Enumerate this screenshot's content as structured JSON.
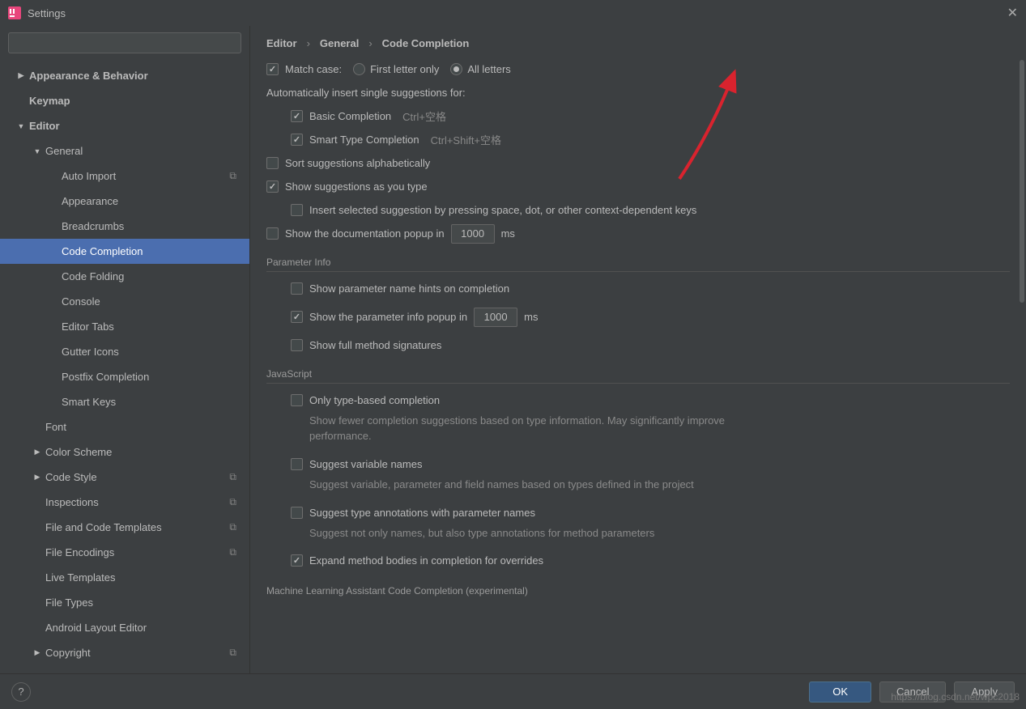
{
  "window": {
    "title": "Settings"
  },
  "search": {
    "placeholder": ""
  },
  "tree": [
    {
      "label": "Appearance & Behavior",
      "lv": 0,
      "arrow": "right",
      "bold": true
    },
    {
      "label": "Keymap",
      "lv": 0,
      "arrow": "",
      "bold": true
    },
    {
      "label": "Editor",
      "lv": 0,
      "arrow": "down",
      "bold": true
    },
    {
      "label": "General",
      "lv": 1,
      "arrow": "down"
    },
    {
      "label": "Auto Import",
      "lv": 2,
      "arrow": "",
      "copy": true
    },
    {
      "label": "Appearance",
      "lv": 2,
      "arrow": ""
    },
    {
      "label": "Breadcrumbs",
      "lv": 2,
      "arrow": ""
    },
    {
      "label": "Code Completion",
      "lv": 2,
      "arrow": "",
      "selected": true
    },
    {
      "label": "Code Folding",
      "lv": 2,
      "arrow": ""
    },
    {
      "label": "Console",
      "lv": 2,
      "arrow": ""
    },
    {
      "label": "Editor Tabs",
      "lv": 2,
      "arrow": ""
    },
    {
      "label": "Gutter Icons",
      "lv": 2,
      "arrow": ""
    },
    {
      "label": "Postfix Completion",
      "lv": 2,
      "arrow": ""
    },
    {
      "label": "Smart Keys",
      "lv": 2,
      "arrow": ""
    },
    {
      "label": "Font",
      "lv": 1,
      "arrow": ""
    },
    {
      "label": "Color Scheme",
      "lv": 1,
      "arrow": "right"
    },
    {
      "label": "Code Style",
      "lv": 1,
      "arrow": "right",
      "copy": true
    },
    {
      "label": "Inspections",
      "lv": 1,
      "arrow": "",
      "copy": true
    },
    {
      "label": "File and Code Templates",
      "lv": 1,
      "arrow": "",
      "copy": true
    },
    {
      "label": "File Encodings",
      "lv": 1,
      "arrow": "",
      "copy": true
    },
    {
      "label": "Live Templates",
      "lv": 1,
      "arrow": ""
    },
    {
      "label": "File Types",
      "lv": 1,
      "arrow": ""
    },
    {
      "label": "Android Layout Editor",
      "lv": 1,
      "arrow": ""
    },
    {
      "label": "Copyright",
      "lv": 1,
      "arrow": "right",
      "copy": true
    }
  ],
  "breadcrumb": {
    "a": "Editor",
    "b": "General",
    "c": "Code Completion"
  },
  "c": {
    "match_case": "Match case:",
    "first_letter": "First letter only",
    "all_letters": "All letters",
    "auto_insert": "Automatically insert single suggestions for:",
    "basic": "Basic Completion",
    "basic_k": "Ctrl+空格",
    "smart": "Smart Type Completion",
    "smart_k": "Ctrl+Shift+空格",
    "sort": "Sort suggestions alphabetically",
    "asutype": "Show suggestions as you type",
    "insertsel": "Insert selected suggestion by pressing space, dot, or other context-dependent keys",
    "docpopup_pre": "Show the documentation popup in",
    "docpopup_val": "1000",
    "docpopup_suf": "ms",
    "sec_param": "Parameter Info",
    "p_hints": "Show parameter name hints on completion",
    "p_popup_pre": "Show the parameter info popup in",
    "p_popup_val": "1000",
    "p_popup_suf": "ms",
    "p_full": "Show full method signatures",
    "sec_js": "JavaScript",
    "js_type": "Only type-based completion",
    "js_type_d": "Show fewer completion suggestions based on type information. May significantly improve performance.",
    "js_var": "Suggest variable names",
    "js_var_d": "Suggest variable, parameter and field names based on types defined in the project",
    "js_ann": "Suggest type annotations with parameter names",
    "js_ann_d": "Suggest not only names, but also type annotations for method parameters",
    "js_expand": "Expand method bodies in completion for overrides",
    "sec_ml": "Machine Learning Assistant Code Completion (experimental)"
  },
  "buttons": {
    "ok": "OK",
    "cancel": "Cancel",
    "apply": "Apply"
  },
  "watermark": "https://blog.csdn.net/wpc2018"
}
